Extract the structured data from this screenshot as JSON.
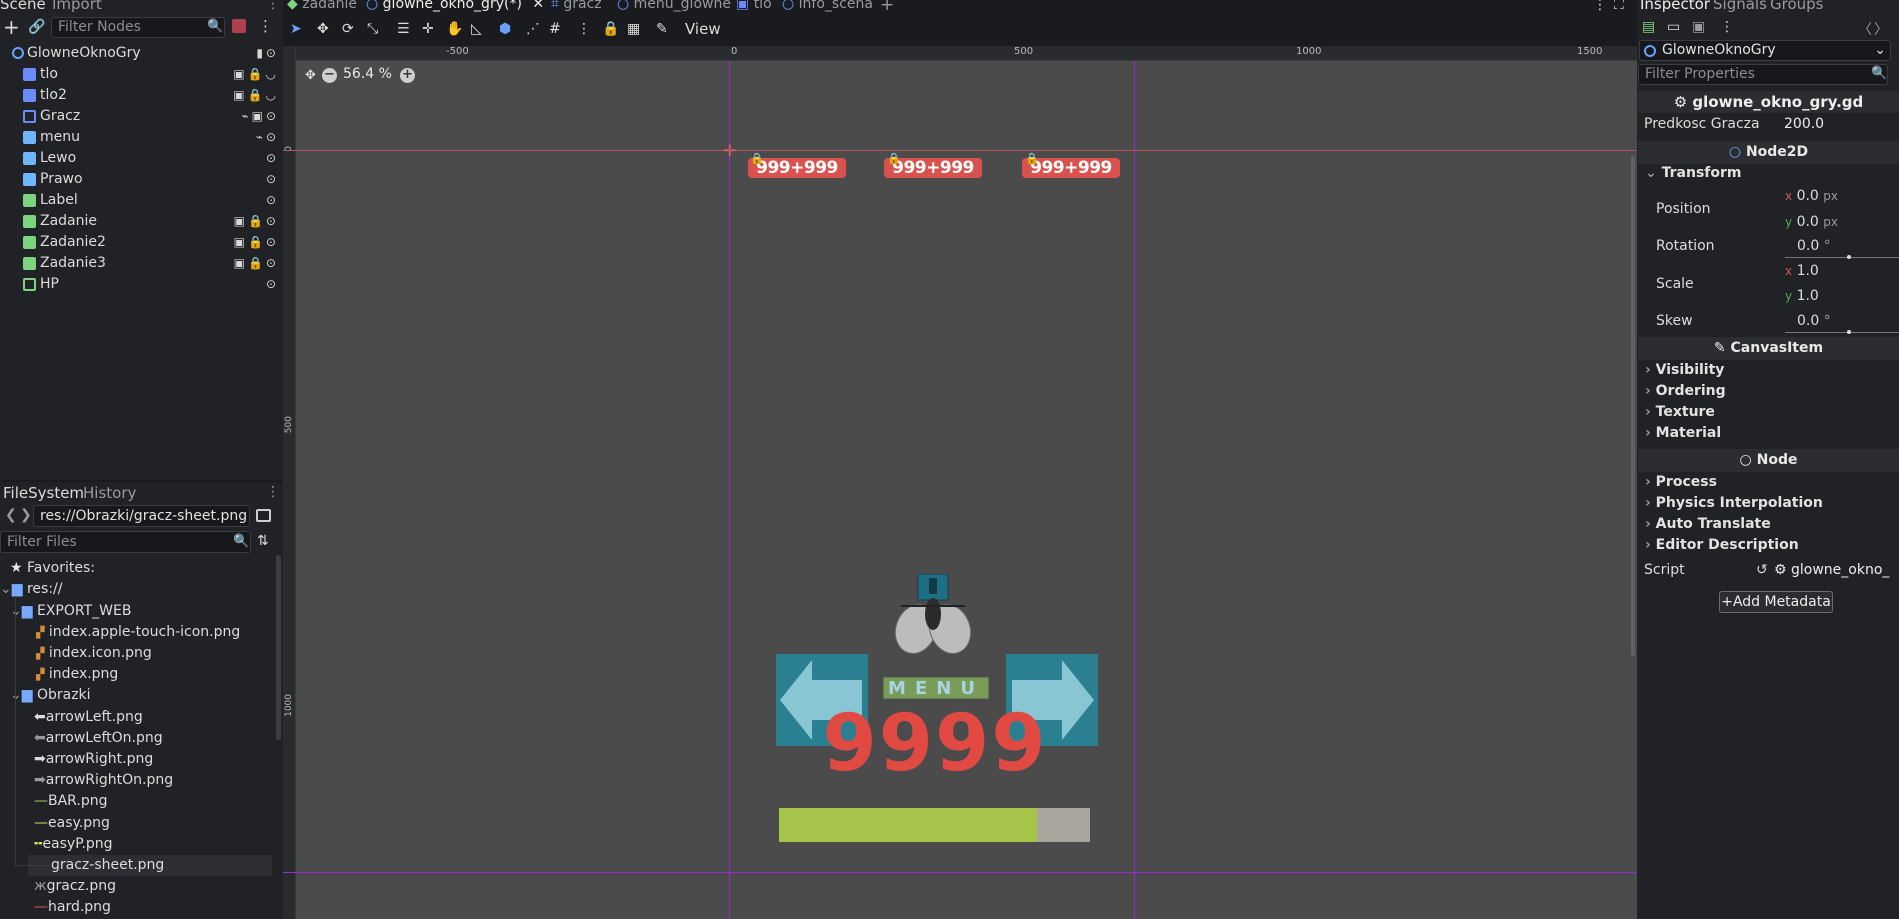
{
  "scene_panel": {
    "tab_scene": "Scene",
    "tab_import": "Import",
    "filter_placeholder": "Filter Nodes",
    "nodes": [
      {
        "label": "GlowneOknoGry",
        "icons": "▮⊙"
      },
      {
        "label": "tlo",
        "icons": "▣🔒◡"
      },
      {
        "label": "tlo2",
        "icons": "▣🔒◡"
      },
      {
        "label": "Gracz",
        "icons": "⌁▣⊙"
      },
      {
        "label": "menu",
        "icons": "⌁⊙"
      },
      {
        "label": "Lewo",
        "icons": "⊙"
      },
      {
        "label": "Prawo",
        "icons": "⊙"
      },
      {
        "label": "Label",
        "icons": "⊙"
      },
      {
        "label": "Zadanie",
        "icons": "▣🔒⊙"
      },
      {
        "label": "Zadanie2",
        "icons": "▣🔒⊙"
      },
      {
        "label": "Zadanie3",
        "icons": "▣🔒⊙"
      },
      {
        "label": "HP",
        "icons": "⊙"
      }
    ]
  },
  "filesystem": {
    "tab_filesystem": "FileSystem",
    "tab_history": "History",
    "path": "res://Obrazki/gracz-sheet.png",
    "filter_placeholder": "Filter Files",
    "items": [
      {
        "label": "Favorites:"
      },
      {
        "label": "res://"
      },
      {
        "label": "EXPORT_WEB"
      },
      {
        "label": "index.apple-touch-icon.png"
      },
      {
        "label": "index.icon.png"
      },
      {
        "label": "index.png"
      },
      {
        "label": "Obrazki"
      },
      {
        "label": "arrowLeft.png"
      },
      {
        "label": "arrowLeftOn.png"
      },
      {
        "label": "arrowRight.png"
      },
      {
        "label": "arrowRightOn.png"
      },
      {
        "label": "BAR.png"
      },
      {
        "label": "easy.png"
      },
      {
        "label": "easyP.png"
      },
      {
        "label": "gracz-sheet.png"
      },
      {
        "label": "gracz.png"
      },
      {
        "label": "hard.png"
      }
    ]
  },
  "tabs": [
    {
      "label": "zadanie"
    },
    {
      "label": "glowne_okno_gry(*)"
    },
    {
      "label": "gracz"
    },
    {
      "label": "menu_glowne"
    },
    {
      "label": "tlo"
    },
    {
      "label": "info_scena"
    }
  ],
  "toolbar": {
    "view_label": "View"
  },
  "viewport": {
    "zoom": "56.4 %",
    "ruler_top": [
      "-500",
      "0",
      "500",
      "1000",
      "1500"
    ],
    "ruler_left": [
      "0",
      "500",
      "1000"
    ],
    "scores": [
      "999+999",
      "999+999",
      "999+999"
    ],
    "menu_text": "MENU",
    "big_number": "9999",
    "hp_fill": 0.83
  },
  "inspector": {
    "tab_inspector": "Inspector",
    "tab_signals": "Signals",
    "tab_groups": "Groups",
    "node_select": "GlowneOknoGry",
    "filter_placeholder": "Filter Properties",
    "script_file": "glowne_okno_gry.gd",
    "predkosc_label": "Predkosc Gracza",
    "predkosc_value": "200.0",
    "sec_node2d": "Node2D",
    "group_transform": "Transform",
    "position_label": "Position",
    "pos_x": "0.0",
    "pos_y": "0.0",
    "unit_px": "px",
    "rotation_label": "Rotation",
    "rotation_value": "0.0",
    "deg": "°",
    "scale_label": "Scale",
    "scale_x": "1.0",
    "scale_y": "1.0",
    "skew_label": "Skew",
    "skew_value": "0.0",
    "sec_canvasitem": "CanvasItem",
    "groups_canvas": [
      "Visibility",
      "Ordering",
      "Texture",
      "Material"
    ],
    "sec_node": "Node",
    "groups_node": [
      "Process",
      "Physics Interpolation",
      "Auto Translate",
      "Editor Description"
    ],
    "script_label": "Script",
    "script_value": "glowne_okno_",
    "add_metadata": "Add Metadata"
  },
  "colors": {
    "accent": "#4a8bff",
    "score_red": "#d9524d",
    "hp_green": "#a6c44a",
    "guide_purple": "#a020f0"
  }
}
